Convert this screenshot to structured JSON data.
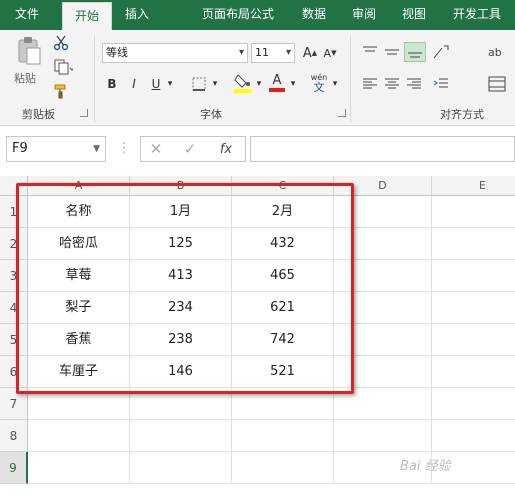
{
  "tabs": [
    {
      "label": "文件"
    },
    {
      "label": "开始",
      "active": true
    },
    {
      "label": "插入"
    },
    {
      "label": "页面布局"
    },
    {
      "label": "公式"
    },
    {
      "label": "数据"
    },
    {
      "label": "审阅"
    },
    {
      "label": "视图"
    },
    {
      "label": "开发工具"
    }
  ],
  "ribbon": {
    "clipboard": {
      "paste": "粘贴",
      "group": "剪贴板"
    },
    "font": {
      "name": "等线",
      "size": "11",
      "group": "字体",
      "bold": "B",
      "italic": "I",
      "underline": "U",
      "grow": "A",
      "shrink": "A",
      "color_letter": "A",
      "wen": "wén",
      "wen_char": "文"
    },
    "align": {
      "group": "对齐方式"
    }
  },
  "formula_bar": {
    "name_box": "F9",
    "formula": ""
  },
  "columns": [
    "A",
    "B",
    "C",
    "D",
    "E"
  ],
  "rows": [
    "1",
    "2",
    "3",
    "4",
    "5",
    "6",
    "7",
    "8",
    "9"
  ],
  "table": [
    [
      "名称",
      "1月",
      "2月"
    ],
    [
      "哈密瓜",
      "125",
      "432"
    ],
    [
      "草莓",
      "413",
      "465"
    ],
    [
      "梨子",
      "234",
      "621"
    ],
    [
      "香蕉",
      "238",
      "742"
    ],
    [
      "车厘子",
      "146",
      "521"
    ]
  ],
  "watermark": "Bai 经验",
  "colors": {
    "excel_green": "#217346",
    "highlight": "#e01f1f"
  }
}
